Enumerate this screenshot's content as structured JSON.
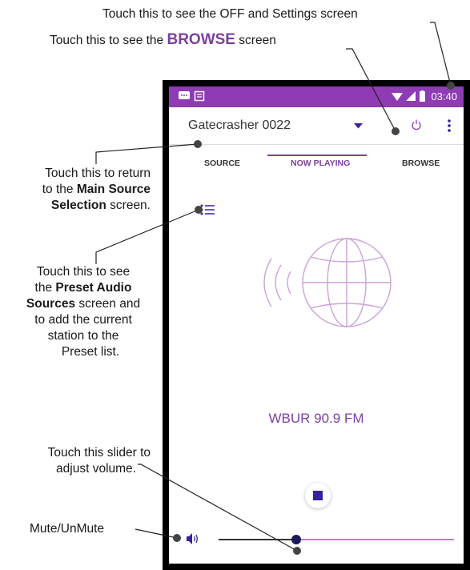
{
  "annotations": {
    "off_settings": "Touch this to see the OFF and Settings screen",
    "browse_prefix": "Touch this to see the",
    "browse_word": "BROWSE",
    "browse_suffix": "screen",
    "source_l1": "Touch this to return",
    "source_l2_pre": "to the",
    "source_l2_bold": "Main Source",
    "source_l3_bold": "Selection",
    "source_l3_post": "screen.",
    "preset_l1": "Touch this to see",
    "preset_l2_pre": "the",
    "preset_l2_bold": "Preset Audio",
    "preset_l3_bold": "Sources",
    "preset_l3_post": "screen and",
    "preset_l4": "to add the current",
    "preset_l5": "station to the",
    "preset_l6": "Preset list.",
    "slider_l1": "Touch this slider to",
    "slider_l2": "adjust volume.",
    "mute": "Mute/UnMute"
  },
  "status_bar": {
    "time": "03:40",
    "color": "#8e3bb4"
  },
  "app_bar": {
    "device_name": "Gatecrasher 0022"
  },
  "tabs": {
    "source": "SOURCE",
    "now_playing": "NOW PLAYING",
    "browse": "BROWSE"
  },
  "now_playing": {
    "station": "WBUR 90.9 FM"
  },
  "volume": {
    "level": 0.33
  },
  "colors": {
    "accent": "#7b3fa0",
    "globe": "#c9a3d8"
  },
  "icons": [
    "message-icon",
    "notification-icon",
    "wifi-icon",
    "signal-icon",
    "battery-icon",
    "dropdown-icon",
    "power-icon",
    "more-vert-icon",
    "preset-list-icon",
    "radio-globe-icon",
    "stop-icon",
    "speaker-icon"
  ]
}
